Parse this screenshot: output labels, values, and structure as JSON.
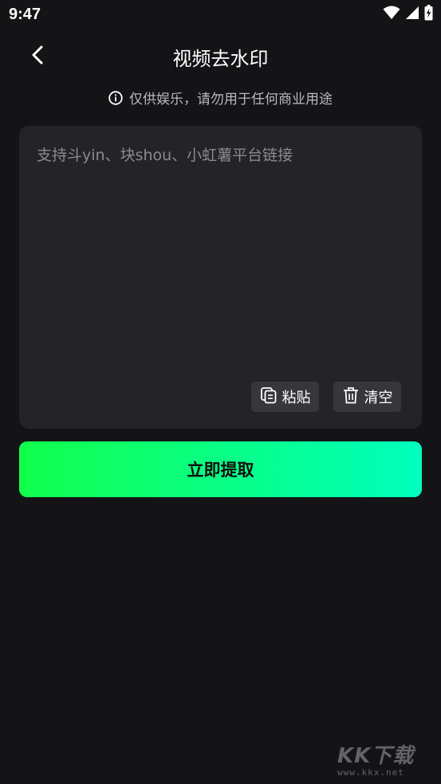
{
  "status_bar": {
    "time": "9:47",
    "icons": [
      "wifi-icon",
      "signal-icon",
      "battery-charging-icon"
    ]
  },
  "header": {
    "back_icon": "chevron-left-icon",
    "title": "视频去水印"
  },
  "notice": {
    "icon": "info-icon",
    "text": "仅供娱乐，请勿用于任何商业用途"
  },
  "input": {
    "value": "",
    "placeholder": "支持斗yin、块shou、小虹薯平台链接"
  },
  "actions": {
    "paste_label": "粘贴",
    "paste_icon": "clipboard-icon",
    "clear_label": "清空",
    "clear_icon": "trash-icon"
  },
  "extract_button": {
    "label": "立即提取",
    "gradient": [
      "#12ff4c",
      "#00ffbe"
    ]
  },
  "watermark": {
    "logo": "KK下载",
    "url": "www.kkx.net"
  },
  "colors": {
    "background": "#141416",
    "card": "#242427",
    "button_secondary": "#37373b",
    "muted_text": "#b9b9bd",
    "placeholder_text": "#8a8a8f"
  }
}
